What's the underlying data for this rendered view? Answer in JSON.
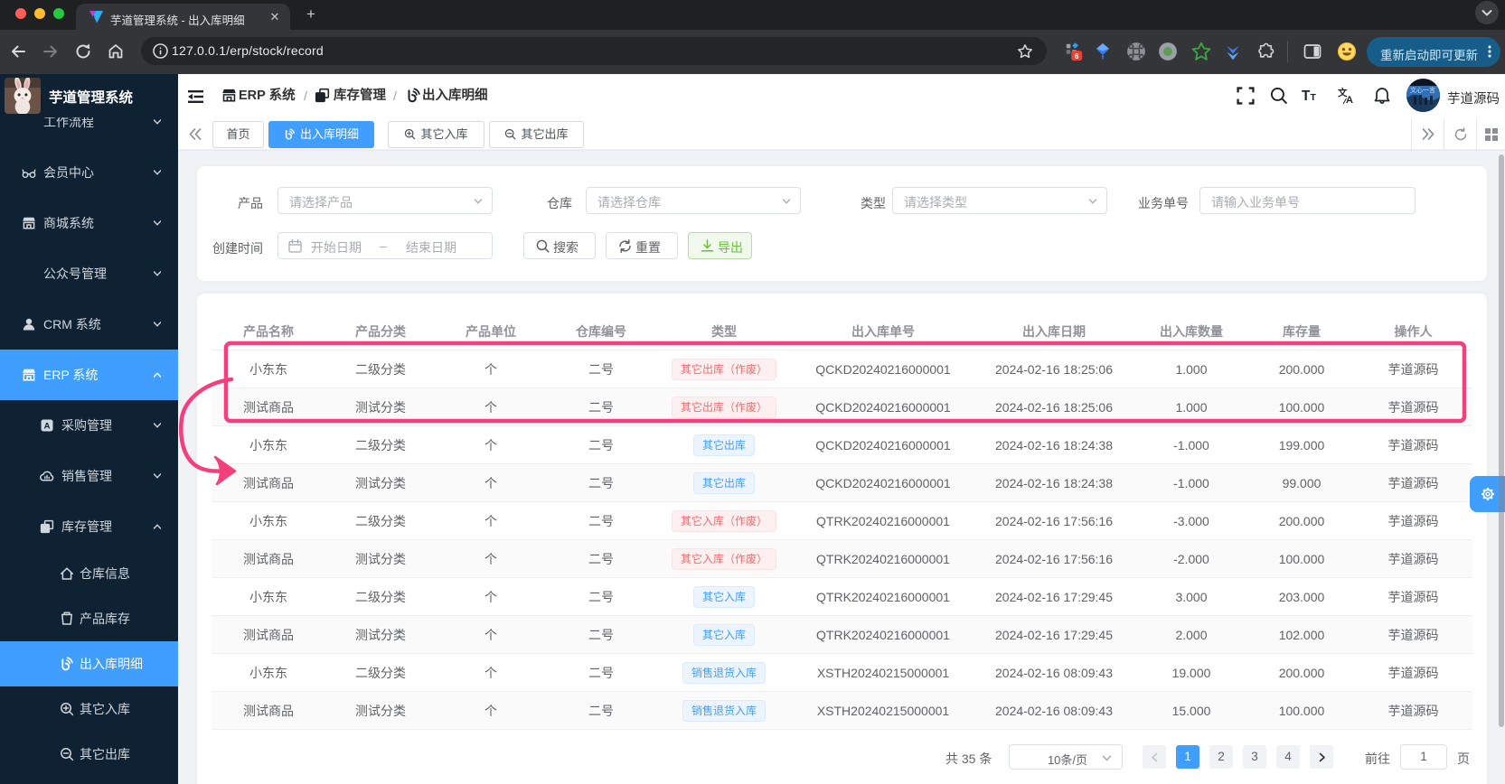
{
  "colors": {
    "primary": "#409eff",
    "annotation": "#f3407c",
    "sidebar_bg": "#0f2233",
    "success_text": "#67c23a",
    "danger_text": "#f56c6c"
  },
  "browser": {
    "tab_title": "芋道管理系统 - 出入库明细",
    "url": "127.0.0.1/erp/stock/record",
    "update_button": "重新启动即可更新",
    "extension_badge": "6"
  },
  "sidebar": {
    "title": "芋道管理系统",
    "items": [
      {
        "label": "工作流程",
        "icon": "",
        "level": 1,
        "chevron": "down",
        "active": false
      },
      {
        "label": "会员中心",
        "icon": "glasses",
        "level": 1,
        "chevron": "down",
        "active": false
      },
      {
        "label": "商城系统",
        "icon": "shop",
        "level": 1,
        "chevron": "down",
        "active": false
      },
      {
        "label": "公众号管理",
        "icon": "",
        "level": 1,
        "chevron": "down",
        "active": false
      },
      {
        "label": "CRM 系统",
        "icon": "user",
        "level": 1,
        "chevron": "down",
        "active": false
      },
      {
        "label": "ERP 系统",
        "icon": "shop",
        "level": 1,
        "chevron": "up",
        "active": true
      },
      {
        "label": "采购管理",
        "icon": "boxa",
        "level": 2,
        "chevron": "down",
        "active": false
      },
      {
        "label": "销售管理",
        "icon": "cloud",
        "level": 2,
        "chevron": "down",
        "active": false
      },
      {
        "label": "库存管理",
        "icon": "stack",
        "level": 2,
        "chevron": "up",
        "active": false
      },
      {
        "label": "仓库信息",
        "icon": "house",
        "level": 3,
        "chevron": "",
        "active": false
      },
      {
        "label": "产品库存",
        "icon": "cup",
        "level": 3,
        "chevron": "",
        "active": false
      },
      {
        "label": "出入库明细",
        "icon": "record",
        "level": 3,
        "chevron": "",
        "active": true
      },
      {
        "label": "其它入库",
        "icon": "zoomin",
        "level": 3,
        "chevron": "",
        "active": false
      },
      {
        "label": "其它出库",
        "icon": "zoomout",
        "level": 3,
        "chevron": "",
        "active": false
      }
    ]
  },
  "header": {
    "breadcrumb": [
      {
        "icon": "shop",
        "label": "ERP 系统"
      },
      {
        "icon": "stack",
        "label": "库存管理"
      },
      {
        "icon": "record",
        "label": "出入库明细"
      }
    ],
    "username": "芋道源码"
  },
  "tabbar": {
    "tabs": [
      {
        "label": "首页",
        "icon": "",
        "active": false
      },
      {
        "label": "出入库明细",
        "icon": "record",
        "active": true
      },
      {
        "label": "其它入库",
        "icon": "zoomin",
        "active": false
      },
      {
        "label": "其它出库",
        "icon": "zoomout",
        "active": false
      }
    ]
  },
  "filters": {
    "product_label": "产品",
    "product_placeholder": "请选择产品",
    "warehouse_label": "仓库",
    "warehouse_placeholder": "请选择仓库",
    "type_label": "类型",
    "type_placeholder": "请选择类型",
    "bizno_label": "业务单号",
    "bizno_placeholder": "请输入业务单号",
    "created_label": "创建时间",
    "date_start_placeholder": "开始日期",
    "date_separator": "–",
    "date_end_placeholder": "结束日期",
    "search_label": "搜索",
    "reset_label": "重置",
    "export_label": "导出"
  },
  "table": {
    "columns": [
      "产品名称",
      "产品分类",
      "产品单位",
      "仓库编号",
      "类型",
      "出入库单号",
      "出入库日期",
      "出入库数量",
      "库存量",
      "操作人"
    ],
    "rows": [
      {
        "name": "小东东",
        "category": "二级分类",
        "unit": "个",
        "warehouse": "二号",
        "tag": "其它出库（作废）",
        "tagtype": "danger",
        "orderno": "QCKD20240216000001",
        "date": "2024-02-16 18:25:06",
        "qty": "1.000",
        "stock": "200.000",
        "operator": "芋道源码"
      },
      {
        "name": "测试商品",
        "category": "测试分类",
        "unit": "个",
        "warehouse": "二号",
        "tag": "其它出库（作废）",
        "tagtype": "danger",
        "orderno": "QCKD20240216000001",
        "date": "2024-02-16 18:25:06",
        "qty": "1.000",
        "stock": "100.000",
        "operator": "芋道源码"
      },
      {
        "name": "小东东",
        "category": "二级分类",
        "unit": "个",
        "warehouse": "二号",
        "tag": "其它出库",
        "tagtype": "primary",
        "orderno": "QCKD20240216000001",
        "date": "2024-02-16 18:24:38",
        "qty": "-1.000",
        "stock": "199.000",
        "operator": "芋道源码"
      },
      {
        "name": "测试商品",
        "category": "测试分类",
        "unit": "个",
        "warehouse": "二号",
        "tag": "其它出库",
        "tagtype": "primary",
        "orderno": "QCKD20240216000001",
        "date": "2024-02-16 18:24:38",
        "qty": "-1.000",
        "stock": "99.000",
        "operator": "芋道源码"
      },
      {
        "name": "小东东",
        "category": "二级分类",
        "unit": "个",
        "warehouse": "二号",
        "tag": "其它入库（作废）",
        "tagtype": "danger",
        "orderno": "QTRK20240216000001",
        "date": "2024-02-16 17:56:16",
        "qty": "-3.000",
        "stock": "200.000",
        "operator": "芋道源码"
      },
      {
        "name": "测试商品",
        "category": "测试分类",
        "unit": "个",
        "warehouse": "二号",
        "tag": "其它入库（作废）",
        "tagtype": "danger",
        "orderno": "QTRK20240216000001",
        "date": "2024-02-16 17:56:16",
        "qty": "-2.000",
        "stock": "100.000",
        "operator": "芋道源码"
      },
      {
        "name": "小东东",
        "category": "二级分类",
        "unit": "个",
        "warehouse": "二号",
        "tag": "其它入库",
        "tagtype": "primary",
        "orderno": "QTRK20240216000001",
        "date": "2024-02-16 17:29:45",
        "qty": "3.000",
        "stock": "203.000",
        "operator": "芋道源码"
      },
      {
        "name": "测试商品",
        "category": "测试分类",
        "unit": "个",
        "warehouse": "二号",
        "tag": "其它入库",
        "tagtype": "primary",
        "orderno": "QTRK20240216000001",
        "date": "2024-02-16 17:29:45",
        "qty": "2.000",
        "stock": "102.000",
        "operator": "芋道源码"
      },
      {
        "name": "小东东",
        "category": "二级分类",
        "unit": "个",
        "warehouse": "二号",
        "tag": "销售退货入库",
        "tagtype": "primary",
        "orderno": "XSTH20240215000001",
        "date": "2024-02-16 08:09:43",
        "qty": "19.000",
        "stock": "200.000",
        "operator": "芋道源码"
      },
      {
        "name": "测试商品",
        "category": "测试分类",
        "unit": "个",
        "warehouse": "二号",
        "tag": "销售退货入库",
        "tagtype": "primary",
        "orderno": "XSTH20240215000001",
        "date": "2024-02-16 08:09:43",
        "qty": "15.000",
        "stock": "100.000",
        "operator": "芋道源码"
      }
    ]
  },
  "pagination": {
    "total": "共 35 条",
    "page_size": "10条/页",
    "pages": [
      "1",
      "2",
      "3",
      "4"
    ],
    "active_page": "1",
    "goto_label": "前往",
    "goto_value": "1",
    "goto_suffix": "页"
  }
}
